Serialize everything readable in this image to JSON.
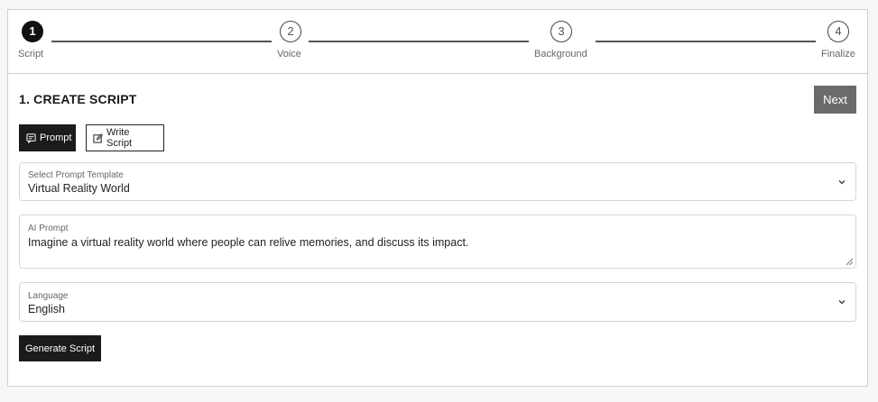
{
  "stepper": {
    "steps": [
      {
        "number": "1",
        "label": "Script",
        "active": true
      },
      {
        "number": "2",
        "label": "Voice",
        "active": false
      },
      {
        "number": "3",
        "label": "Background",
        "active": false
      },
      {
        "number": "4",
        "label": "Finalize",
        "active": false
      }
    ]
  },
  "header": {
    "title": "1. CREATE SCRIPT",
    "next_label": "Next"
  },
  "modes": {
    "prompt_label": "Prompt",
    "write_label": "Write Script",
    "selected": "Prompt"
  },
  "template_select": {
    "label": "Select Prompt Template",
    "value": "Virtual Reality World"
  },
  "ai_prompt": {
    "label": "AI Prompt",
    "value": "Imagine a virtual reality world where people can relive memories, and discuss its impact."
  },
  "language_select": {
    "label": "Language",
    "value": "English"
  },
  "actions": {
    "generate_label": "Generate Script"
  },
  "icons": {
    "prompt": "chat-icon",
    "write": "edit-icon",
    "select": "chevron-down-icon"
  },
  "colors": {
    "active_step": "#111111",
    "next_button": "#6b6b6b",
    "primary_button": "#1b1b1b"
  }
}
